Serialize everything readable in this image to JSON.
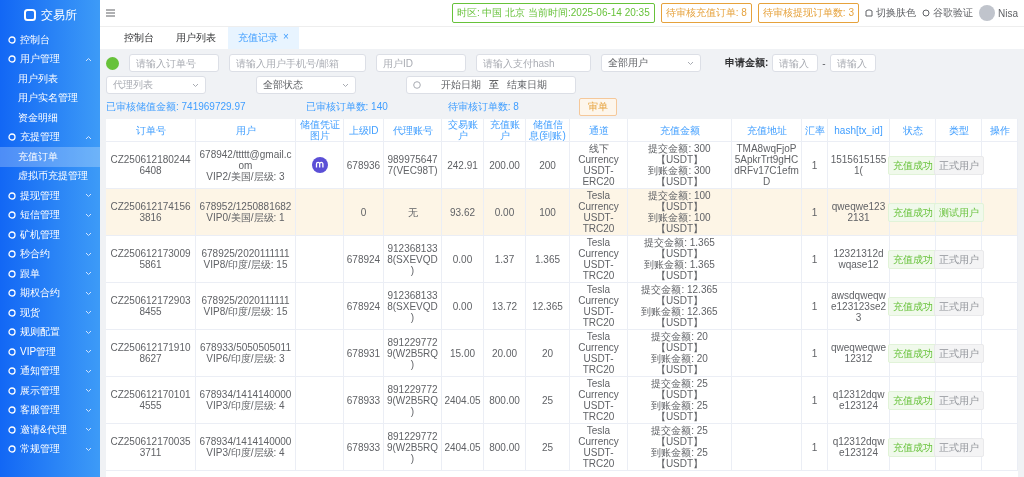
{
  "brand": {
    "title": "交易所"
  },
  "sidebar": {
    "items": [
      {
        "label": "控制台"
      },
      {
        "label": "用户管理",
        "expanded": true,
        "children": [
          {
            "label": "用户列表",
            "selected": false
          },
          {
            "label": "用户实名管理",
            "selected": false
          },
          {
            "label": "资金明细",
            "selected": false
          }
        ]
      },
      {
        "label": "充提管理",
        "expanded": true,
        "children": [
          {
            "label": "充值订单",
            "selected": true
          },
          {
            "label": "虚拟币充提管理",
            "selected": false
          }
        ]
      },
      {
        "label": "提现管理",
        "expanded": false
      },
      {
        "label": "短信管理",
        "expanded": false
      },
      {
        "label": "矿机管理",
        "expanded": false
      },
      {
        "label": "秒合约",
        "expanded": false
      },
      {
        "label": "跟单",
        "expanded": false
      },
      {
        "label": "期权合约",
        "expanded": false
      },
      {
        "label": "现货",
        "expanded": false
      },
      {
        "label": "规则配置",
        "expanded": false
      },
      {
        "label": "VIP管理",
        "expanded": false
      },
      {
        "label": "通知管理",
        "expanded": false
      },
      {
        "label": "展示管理",
        "expanded": false
      },
      {
        "label": "客服管理",
        "expanded": false
      },
      {
        "label": "邀请&代理",
        "expanded": false
      },
      {
        "label": "常规管理",
        "expanded": false
      }
    ]
  },
  "header": {
    "notices": [
      {
        "text": "时区: 中国 北京 当前时间:2025-06-14 20:35",
        "color": "#67c23a"
      },
      {
        "text": "待审核充值订单: 8",
        "color": "#e6a23c"
      },
      {
        "text": "待审核提现订单数: 3",
        "color": "#e6a23c"
      }
    ],
    "actions": [
      "切换肤色",
      "谷歌验证"
    ],
    "user": "Nisa"
  },
  "tabs": [
    {
      "label": "控制台",
      "selected": false
    },
    {
      "label": "用户列表",
      "selected": false
    },
    {
      "label": "充值记录",
      "selected": true,
      "close": "×"
    }
  ],
  "filters": {
    "row_1": [
      {
        "kind": "input",
        "placeholder": "请输入订单号"
      },
      {
        "kind": "input",
        "placeholder": "请输入用户手机号/邮箱"
      },
      {
        "kind": "input",
        "placeholder": "用户ID"
      },
      {
        "kind": "input",
        "placeholder": "请输入支付hash"
      },
      {
        "kind": "select",
        "value": "全部用户"
      }
    ],
    "amount": {
      "label": "申请金额:",
      "min_placeholder": "请输入",
      "separator": "-",
      "max_placeholder": "请输入"
    },
    "row_2": [
      {
        "kind": "select",
        "placeholder": "代理列表"
      },
      {
        "kind": "select",
        "value": "全部状态"
      }
    ],
    "date": {
      "start_placeholder": "开始日期",
      "separator": "至",
      "end_placeholder": "结束日期"
    }
  },
  "stats": [
    "已审核储值金额: 741969729.97",
    "已审核订单数: 140",
    "待审核订单数: 8"
  ],
  "review_button": "审单",
  "table": {
    "columns": [
      "订单号",
      "用户",
      "储值凭证图片",
      "上级ID",
      "代理账号",
      "交易账户",
      "充值账户",
      "储值信息(到账)",
      "通道",
      "充值金额",
      "充值地址",
      "汇率",
      "hash[tx_id]",
      "状态",
      "类型",
      "操作"
    ],
    "rows": [
      {
        "selected": false,
        "order": "CZ2506121802446408",
        "user": [
          "678942/ttttt@gmail.com",
          "VIP2/美国/层级: 3"
        ],
        "has_voucher": true,
        "parent_id": "678936",
        "agent": "9899756477(VEC98T)",
        "trade": "242.91",
        "recharge": "200.00",
        "stored": "200",
        "channel": "线下 Currency USDT-ERC20",
        "amount": [
          "提交金额: 300【USDT】",
          "到账金额: 300【USDT】"
        ],
        "address": "TMA8wqFjoP5ApkrTrt9gHCdRFv17C1efmD",
        "rate": "1",
        "hash": "1515615155 1(",
        "status": "充值成功",
        "type": {
          "label": "正式用户",
          "kind": "formal"
        }
      },
      {
        "selected": true,
        "order": "CZ2506121741563816",
        "user": [
          "678952/1250881682",
          "VIP0/美国/层级: 1"
        ],
        "has_voucher": false,
        "parent_id": "0",
        "agent": "无",
        "trade": "93.62",
        "recharge": "0.00",
        "stored": "100",
        "channel": "Tesla Currency USDT-TRC20",
        "amount": [
          "提交金额: 100【USDT】",
          "到账金额: 100【USDT】"
        ],
        "address": "",
        "rate": "1",
        "hash": "qweqwe1232131",
        "status": "充值成功",
        "type": {
          "label": "测试用户",
          "kind": "test"
        }
      },
      {
        "selected": false,
        "order": "CZ2506121730095861",
        "user": [
          "678925/2020111111",
          "VIP8/印度/层级: 15"
        ],
        "has_voucher": false,
        "parent_id": "678924",
        "agent": "9123681338(SXEVQD)",
        "trade": "0.00",
        "recharge": "1.37",
        "stored": "1.365",
        "channel": "Tesla Currency USDT-TRC20",
        "amount": [
          "提交金额: 1.365【USDT】",
          "到账金额: 1.365【USDT】"
        ],
        "address": "",
        "rate": "1",
        "hash": "12321312dwqase12",
        "status": "充值成功",
        "type": {
          "label": "正式用户",
          "kind": "formal"
        }
      },
      {
        "selected": false,
        "order": "CZ2506121729038455",
        "user": [
          "678925/2020111111",
          "VIP8/印度/层级: 15"
        ],
        "has_voucher": false,
        "parent_id": "678924",
        "agent": "9123681338(SXEVQD)",
        "trade": "0.00",
        "recharge": "13.72",
        "stored": "12.365",
        "channel": "Tesla Currency USDT-TRC20",
        "amount": [
          "提交金额: 12.365【USDT】",
          "到账金额: 12.365【USDT】"
        ],
        "address": "",
        "rate": "1",
        "hash": "awsdqweqwe123123se23",
        "status": "充值成功",
        "type": {
          "label": "正式用户",
          "kind": "formal"
        }
      },
      {
        "selected": false,
        "order": "CZ2506121719108627",
        "user": [
          "678933/5050505011",
          "VIP6/印度/层级: 3"
        ],
        "has_voucher": false,
        "parent_id": "678931",
        "agent": "8912297729(W2B5RQ)",
        "trade": "15.00",
        "recharge": "20.00",
        "stored": "20",
        "channel": "Tesla Currency USDT-TRC20",
        "amount": [
          "提交金额: 20【USDT】",
          "到账金额: 20【USDT】"
        ],
        "address": "",
        "rate": "1",
        "hash": "qweqweqwe12312",
        "status": "充值成功",
        "type": {
          "label": "正式用户",
          "kind": "formal"
        }
      },
      {
        "selected": false,
        "order": "CZ2506121701014555",
        "user": [
          "678934/1414140000",
          "VIP3/印度/层级: 4"
        ],
        "has_voucher": false,
        "parent_id": "678933",
        "agent": "8912297729(W2B5RQ)",
        "trade": "2404.05",
        "recharge": "800.00",
        "stored": "25",
        "channel": "Tesla Currency USDT-TRC20",
        "amount": [
          "提交金额: 25【USDT】",
          "到账金额: 25【USDT】"
        ],
        "address": "",
        "rate": "1",
        "hash": "q12312dqwe123124",
        "status": "充值成功",
        "type": {
          "label": "正式用户",
          "kind": "formal"
        }
      },
      {
        "selected": false,
        "order": "CZ2506121700353711",
        "user": [
          "678934/1414140000",
          "VIP3/印度/层级: 4"
        ],
        "has_voucher": false,
        "parent_id": "678933",
        "agent": "8912297729(W2B5RQ)",
        "trade": "2404.05",
        "recharge": "800.00",
        "stored": "25",
        "channel": "Tesla Currency USDT-TRC20",
        "amount": [
          "提交金额: 25【USDT】",
          "到账金额: 25【USDT】"
        ],
        "address": "",
        "rate": "1",
        "hash": "q12312dqwe123124",
        "status": "充值成功",
        "type": {
          "label": "正式用户",
          "kind": "formal"
        }
      }
    ]
  }
}
